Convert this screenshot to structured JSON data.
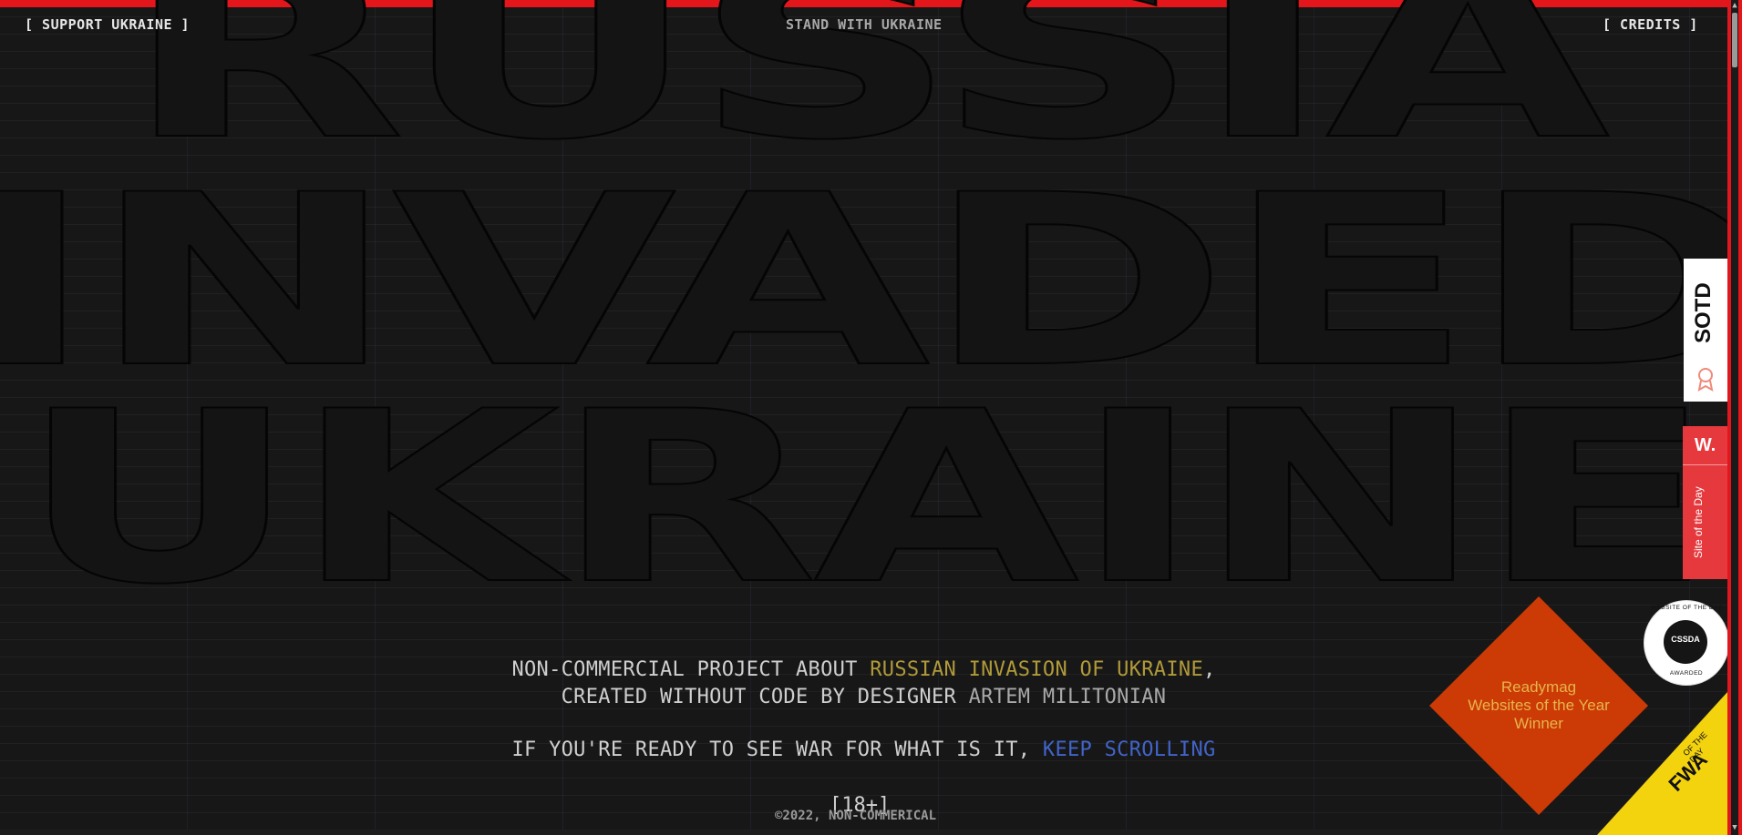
{
  "nav": {
    "support_label": "[ SUPPORT UKRAINE ]",
    "stand_label": "STAND WITH UKRAINE",
    "credits_label": "[ CREDITS ]"
  },
  "hero": {
    "line1": "RUSSIA",
    "line2": "INVADED",
    "line3": "UKRAINE"
  },
  "intro": {
    "line1_prefix": "NON-COMMERCIAL PROJECT ABOUT ",
    "line1_highlight": "RUSSIAN INVASION OF UKRAINE",
    "line1_suffix": ",",
    "line2_prefix": "CREATED WITHOUT CODE BY DESIGNER ",
    "line2_highlight": "ARTEM MILITONIAN",
    "line3_prefix": "IF YOU'RE READY TO SEE WAR FOR WHAT IS IT, ",
    "line3_link": "KEEP SCROLLING",
    "age": "[18+]"
  },
  "footer": {
    "copyright": "©2022, NON-COMMERICAL"
  },
  "awards": {
    "sotd_label": "SOTD",
    "sotd_icon": "ribbon-icon",
    "awwwards_logo": "W.",
    "awwwards_label": "Site of the Day",
    "cssda_top": "WEBSITE OF THE DAY",
    "cssda_center": "CSSDA",
    "cssda_bottom": "AWARDED",
    "readymag_line1": "Readymag",
    "readymag_line2": "Websites of the Year",
    "readymag_line3": "Winner",
    "fwa_logo": "FWA",
    "fwa_sub": "OF THE DAY"
  },
  "colors": {
    "accent_red": "#e3161b",
    "highlight_yellow": "#b09a3a",
    "link_blue": "#4164c9",
    "readymag_orange": "#cc3a06",
    "fwa_yellow": "#f3d20e"
  }
}
